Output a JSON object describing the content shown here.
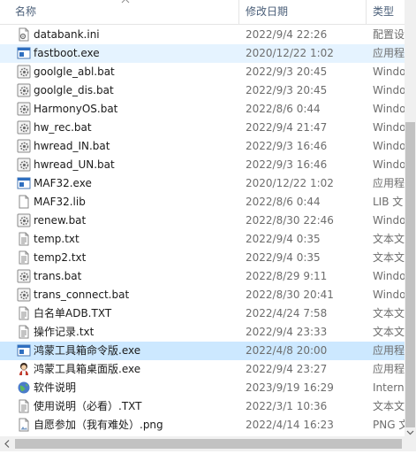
{
  "columns": {
    "name": "名称",
    "date": "修改日期",
    "type": "类型"
  },
  "colors": {
    "selected_bg": "#cce8ff",
    "hover_bg": "#e5f3ff",
    "header_text": "#4c607a"
  },
  "files": [
    {
      "name": "databank.ini",
      "date": "2022/9/4 22:26",
      "type": "配置设",
      "icon": "ini-settings-icon"
    },
    {
      "name": "fastboot.exe",
      "date": "2020/12/22 1:02",
      "type": "应用程",
      "icon": "exe-app-icon"
    },
    {
      "name": "goolgle_abl.bat",
      "date": "2022/9/3 20:45",
      "type": "Windo",
      "icon": "bat-gear-icon"
    },
    {
      "name": "goolgle_dis.bat",
      "date": "2022/9/3 20:45",
      "type": "Windo",
      "icon": "bat-gear-icon"
    },
    {
      "name": "HarmonyOS.bat",
      "date": "2022/8/6 0:44",
      "type": "Windo",
      "icon": "bat-gear-icon"
    },
    {
      "name": "hw_rec.bat",
      "date": "2022/9/4 21:47",
      "type": "Windo",
      "icon": "bat-gear-icon"
    },
    {
      "name": "hwread_IN.bat",
      "date": "2022/9/3 16:46",
      "type": "Windo",
      "icon": "bat-gear-icon"
    },
    {
      "name": "hwread_UN.bat",
      "date": "2022/9/3 16:46",
      "type": "Windo",
      "icon": "bat-gear-icon"
    },
    {
      "name": "MAF32.exe",
      "date": "2020/12/22 1:02",
      "type": "应用程",
      "icon": "exe-app-icon"
    },
    {
      "name": "MAF32.lib",
      "date": "2022/8/6 0:44",
      "type": "LIB 文",
      "icon": "blank-file-icon"
    },
    {
      "name": "renew.bat",
      "date": "2022/8/30 22:46",
      "type": "Windo",
      "icon": "bat-gear-icon"
    },
    {
      "name": "temp.txt",
      "date": "2022/9/4 0:35",
      "type": "文本文",
      "icon": "text-file-icon"
    },
    {
      "name": "temp2.txt",
      "date": "2022/9/4 0:35",
      "type": "文本文",
      "icon": "text-file-icon"
    },
    {
      "name": "trans.bat",
      "date": "2022/8/29 9:11",
      "type": "Windo",
      "icon": "bat-gear-icon"
    },
    {
      "name": "trans_connect.bat",
      "date": "2022/8/30 20:41",
      "type": "Windo",
      "icon": "bat-gear-icon"
    },
    {
      "name": "白名单ADB.TXT",
      "date": "2022/4/24 7:58",
      "type": "文本文",
      "icon": "text-file-icon"
    },
    {
      "name": "操作记录.txt",
      "date": "2022/9/4 23:33",
      "type": "文本文",
      "icon": "text-file-icon"
    },
    {
      "name": "鸿蒙工具箱命令版.exe",
      "date": "2022/4/8 20:00",
      "type": "应用程",
      "icon": "exe-app-icon"
    },
    {
      "name": "鸿蒙工具箱桌面版.exe",
      "date": "2022/9/4 23:27",
      "type": "应用程",
      "icon": "character-app-icon"
    },
    {
      "name": "软件说明",
      "date": "2023/9/19 16:29",
      "type": "Intern",
      "icon": "internet-shortcut-icon"
    },
    {
      "name": "使用说明（必看）.TXT",
      "date": "2022/3/1 10:36",
      "type": "文本文",
      "icon": "text-file-icon"
    },
    {
      "name": "自愿参加（我有难处）.png",
      "date": "2022/4/14 16:23",
      "type": "PNG 文",
      "icon": "image-file-icon"
    }
  ]
}
